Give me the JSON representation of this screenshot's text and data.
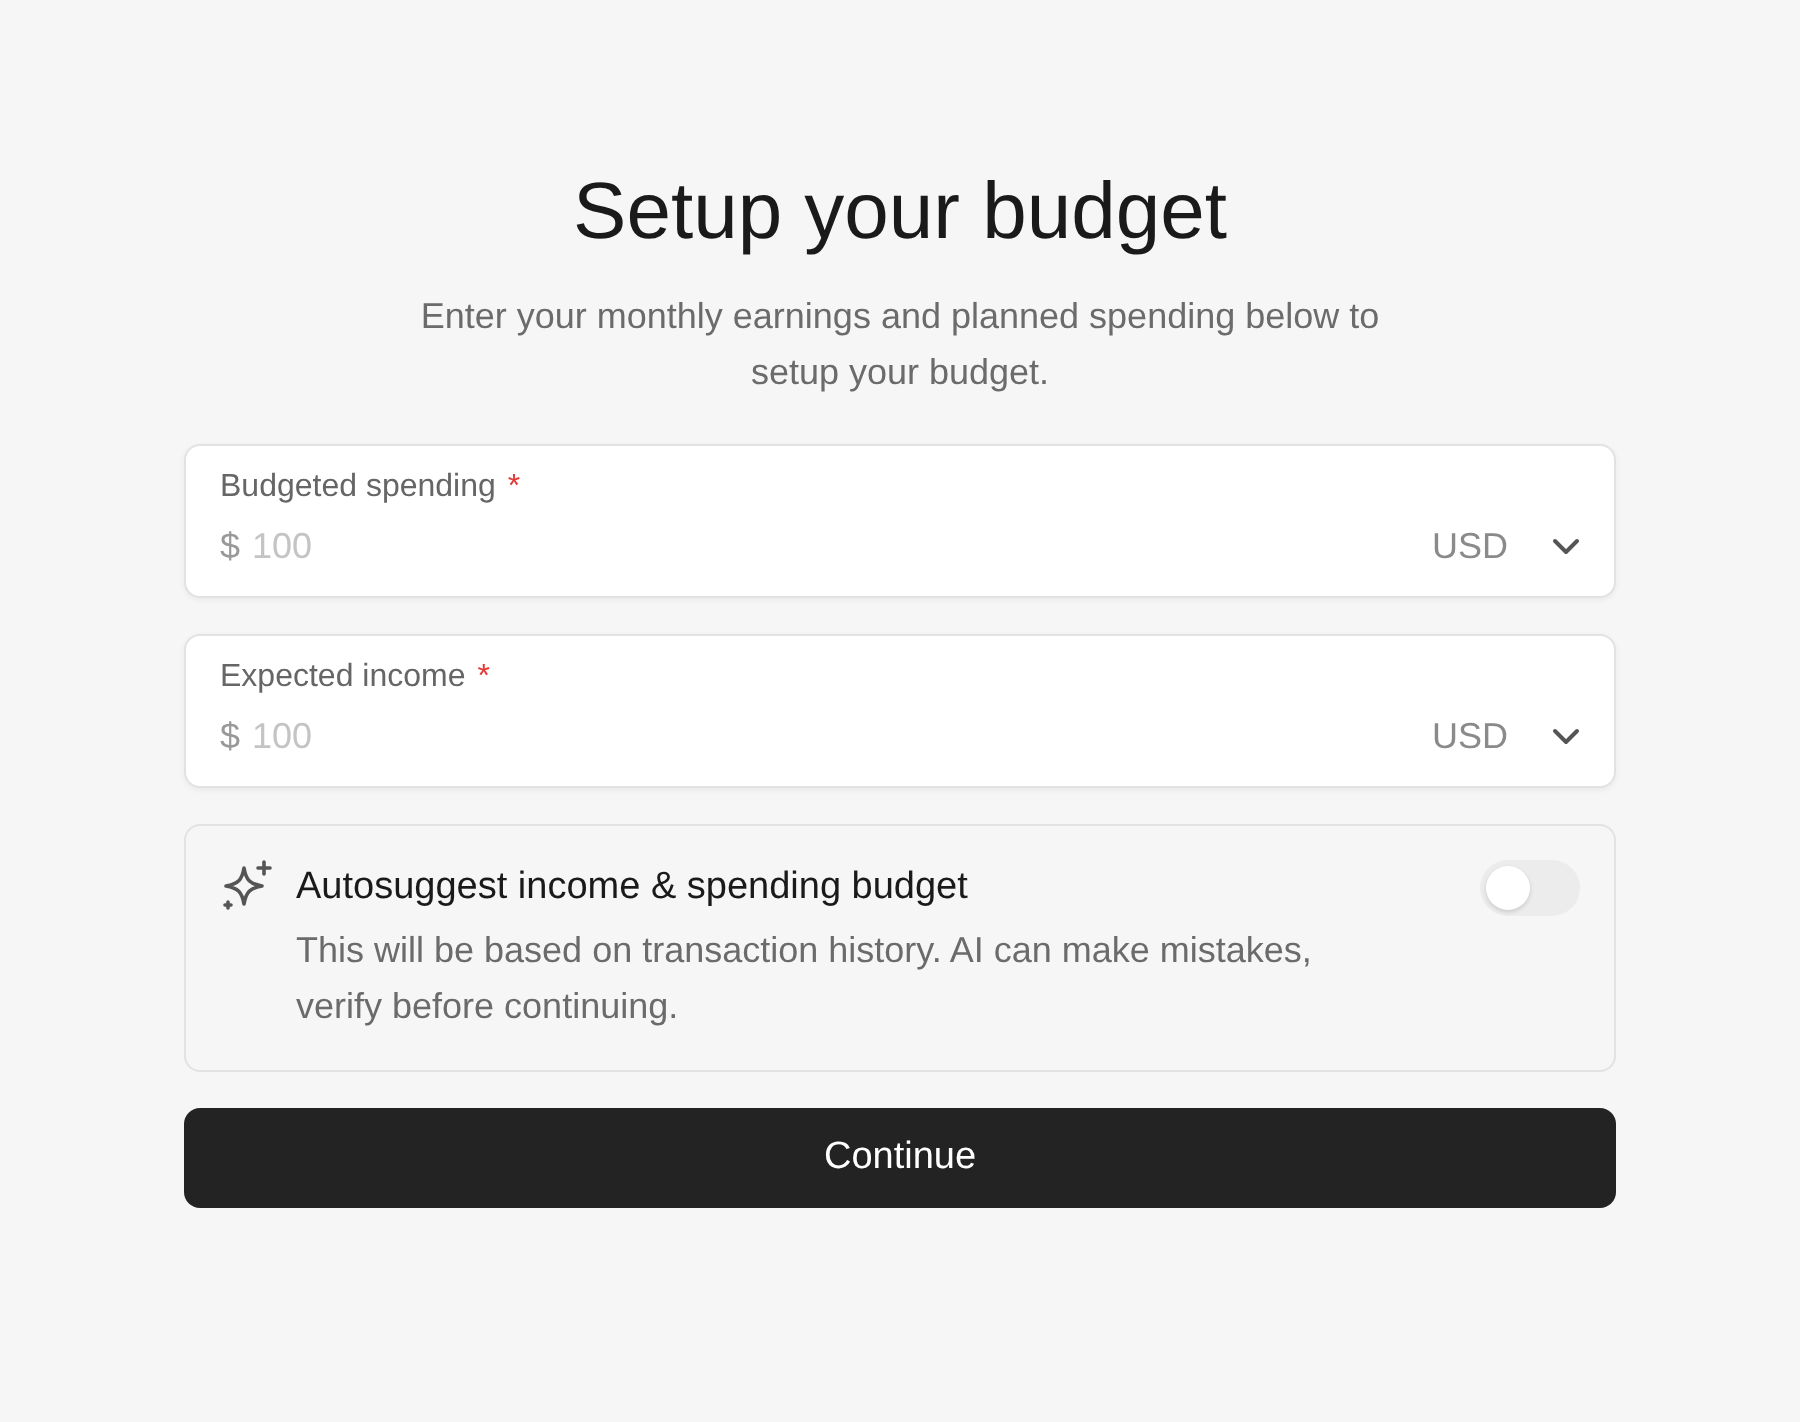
{
  "title": "Setup your budget",
  "subtitle": "Enter your monthly earnings and planned spending below to setup your budget.",
  "fields": [
    {
      "label": "Budgeted spending",
      "required": true,
      "required_mark": "*",
      "prefix": "$",
      "placeholder": "100",
      "currency": "USD"
    },
    {
      "label": "Expected income",
      "required": true,
      "required_mark": "*",
      "prefix": "$",
      "placeholder": "100",
      "currency": "USD"
    }
  ],
  "autosuggest": {
    "title": "Autosuggest income & spending budget",
    "description": "This will be based on transaction history. AI can make mistakes, verify before continuing.",
    "on": false
  },
  "button": "Continue"
}
